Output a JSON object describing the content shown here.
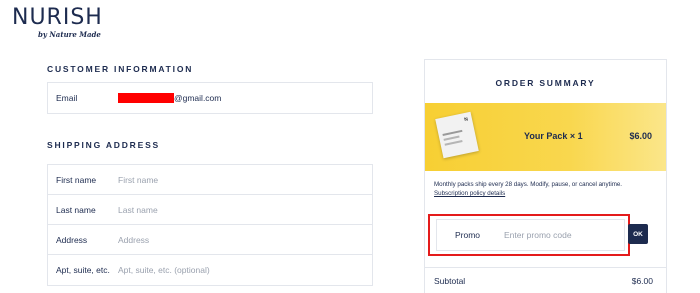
{
  "brand": {
    "wordmark": "NURISH",
    "byline": "by Nature Made"
  },
  "customer_info": {
    "title": "CUSTOMER INFORMATION",
    "email_label": "Email",
    "email_suffix": "@gmail.com"
  },
  "shipping": {
    "title": "SHIPPING ADDRESS",
    "fields": [
      {
        "label": "First name",
        "placeholder": "First name"
      },
      {
        "label": "Last name",
        "placeholder": "Last name"
      },
      {
        "label": "Address",
        "placeholder": "Address"
      },
      {
        "label": "Apt, suite, etc.",
        "placeholder": "Apt, suite, etc. (optional)"
      }
    ]
  },
  "summary": {
    "title": "ORDER SUMMARY",
    "pack_name": "Your Pack × 1",
    "pack_price": "$6.00",
    "pack_image_text": "N",
    "note": "Monthly packs ship every 28 days. Modify, pause, or cancel anytime.",
    "policy_link": "Subscription policy details",
    "promo_label": "Promo",
    "promo_placeholder": "Enter promo code",
    "ok_label": "OK",
    "subtotal_label": "Subtotal",
    "subtotal_value": "$6.00"
  },
  "colors": {
    "navy": "#1d2b4f",
    "highlight": "#e41b1b",
    "redaction": "#ff0000",
    "pack_yellow": "#f7cf33"
  }
}
